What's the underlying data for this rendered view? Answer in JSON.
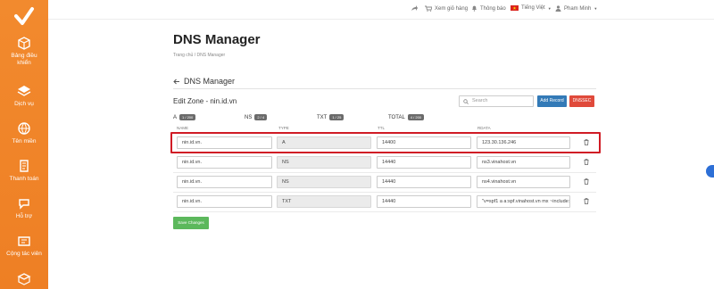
{
  "sidebar": {
    "items": [
      {
        "label_line1": "Bảng điều",
        "label_line2": "khiển",
        "icon": "dashboard-icon"
      },
      {
        "label_line1": "Dịch vụ",
        "label_line2": "",
        "icon": "services-icon"
      },
      {
        "label_line1": "Tên miền",
        "label_line2": "",
        "icon": "domain-icon"
      },
      {
        "label_line1": "Thanh toán",
        "label_line2": "",
        "icon": "payment-icon"
      },
      {
        "label_line1": "Hỗ trợ",
        "label_line2": "",
        "icon": "support-icon"
      },
      {
        "label_line1": "Cộng tác viên",
        "label_line2": "",
        "icon": "affiliate-icon"
      }
    ]
  },
  "topbar": {
    "cart": "Xem giỏ hàng",
    "notifications": "Thông báo",
    "language": "Tiếng Việt",
    "user": "Pham Minh"
  },
  "page": {
    "title": "DNS Manager",
    "breadcrumb": "Trang chủ  /  DNS Manager",
    "section_title": "DNS Manager",
    "edit_zone": "Edit Zone - nin.id.vn"
  },
  "toolbar": {
    "search_placeholder": "Search",
    "add_record": "Add Record",
    "dnssec": "DNSSEC"
  },
  "counts": {
    "a_label": "A",
    "a_badge": "1 / 200",
    "ns_label": "NS",
    "ns_badge": "2 / 4",
    "txt_label": "TXT",
    "txt_badge": "1 / 25",
    "total_label": "TOTAL",
    "total_badge": "4 / 200"
  },
  "columns": {
    "name": "NAME",
    "type": "TYPE",
    "ttl": "TTL",
    "rdata": "RDATA"
  },
  "records": [
    {
      "name": "nin.id.vn.",
      "type": "A",
      "ttl": "14400",
      "rdata": "123.30.136.246"
    },
    {
      "name": "nin.id.vn.",
      "type": "NS",
      "ttl": "14440",
      "rdata": "ns3.vinahost.vn"
    },
    {
      "name": "nin.id.vn.",
      "type": "NS",
      "ttl": "14440",
      "rdata": "ns4.vinahost.vn"
    },
    {
      "name": "nin.id.vn.",
      "type": "TXT",
      "ttl": "14440",
      "rdata": "\"v=spf1 a a:spf.vinahost.vn mx ~include:s"
    }
  ],
  "save_label": "Save Changes",
  "colors": {
    "sidebar": "#ee7f24",
    "primary": "#337ab7",
    "danger": "#e04a3b",
    "success": "#5cb85c",
    "highlight": "#d01b25"
  }
}
